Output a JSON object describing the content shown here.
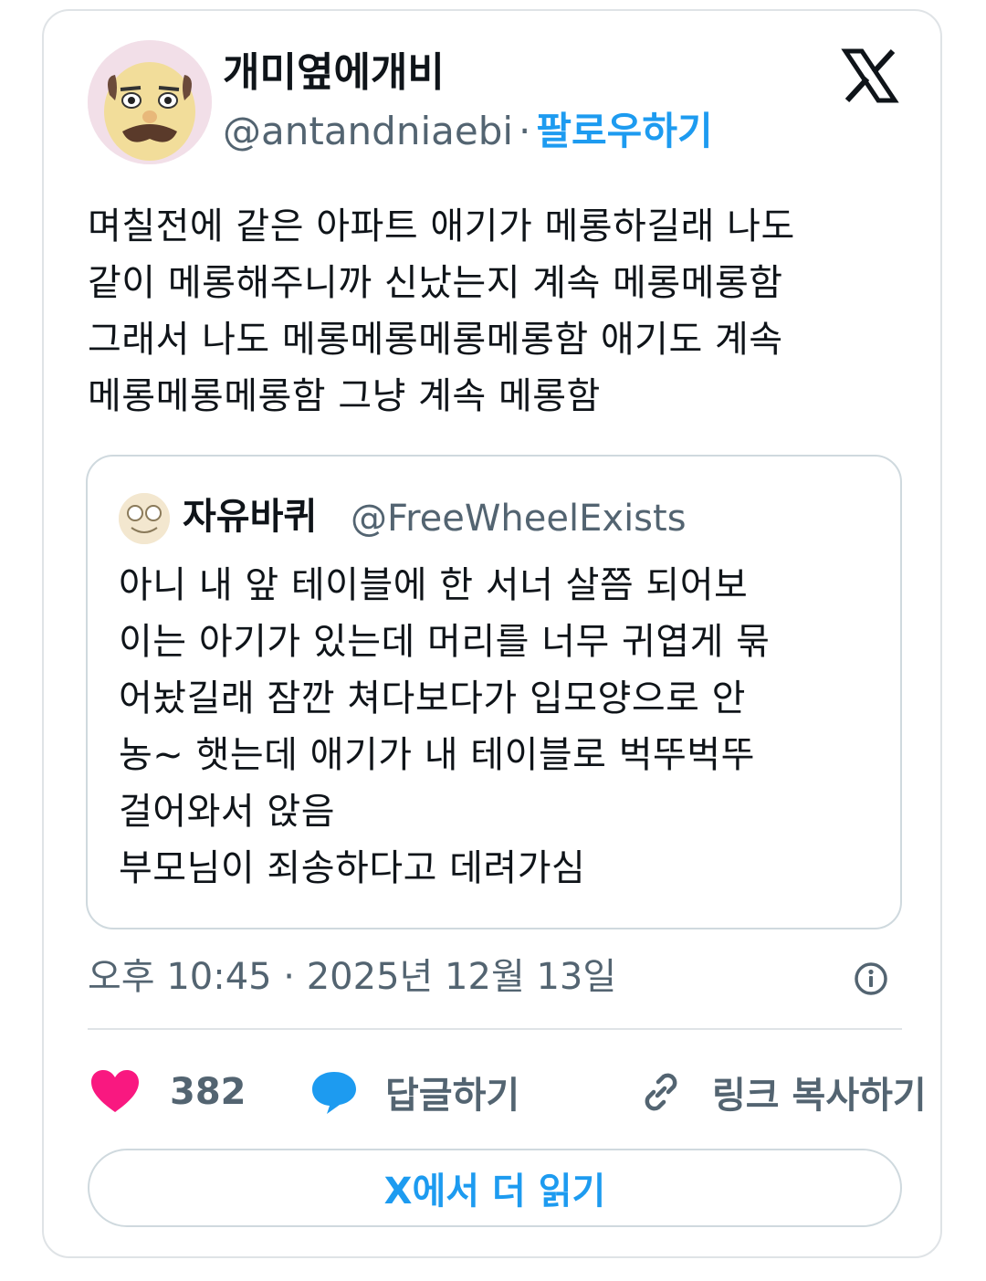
{
  "author": {
    "display_name": "개미옆에개비",
    "handle": "@antandniaebi",
    "separator": "·",
    "follow_label": "팔로우하기"
  },
  "tweet": {
    "text": "며칠전에 같은 아파트 애기가 메롱하길래 나도\n같이 메롱해주니까 신났는지 계속 메롱메롱함\n그래서 나도 메롱메롱메롱메롱함 애기도 계속\n메롱메롱메롱함 그냥 계속 메롱함"
  },
  "quote": {
    "display_name": "자유바퀴",
    "handle": "@FreeWheelExists",
    "text": "아니 내 앞 테이블에 한 서너 살쯤 되어보\n이는 아기가 있는데 머리를 너무 귀엽게 묶\n어놨길래 잠깐 쳐다보다가 입모양으로 안\n농~ 햇는데 애기가 내 테이블로 벅뚜벅뚜\n걸어와서 앉음\n부모님이 죄송하다고 데려가심"
  },
  "meta": {
    "timestamp": "오후 10:45 · 2025년 12월 13일"
  },
  "actions": {
    "like_count": "382",
    "reply_label": "답글하기",
    "copy_link_label": "링크 복사하기"
  },
  "read_more_label": "X에서 더 읽기",
  "icons": {
    "brand": "x-logo-icon",
    "info": "info-icon",
    "like": "heart-icon",
    "reply": "speech-bubble-icon",
    "link": "link-icon"
  },
  "colors": {
    "accent": "#1d9bf0",
    "like": "#f91880",
    "secondary_text": "#536471",
    "border": "#cfd9de"
  }
}
